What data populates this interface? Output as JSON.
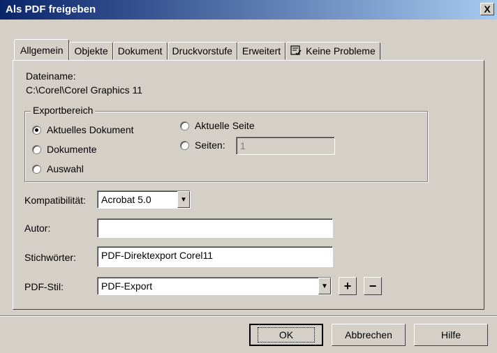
{
  "window": {
    "title": "Als PDF freigeben",
    "close_label": "X"
  },
  "tabs": [
    {
      "label": "Allgemein",
      "active": true
    },
    {
      "label": "Objekte"
    },
    {
      "label": "Dokument"
    },
    {
      "label": "Druckvorstufe"
    },
    {
      "label": "Erweitert"
    },
    {
      "label": "Keine Probleme",
      "icon": "checklist-icon"
    }
  ],
  "general": {
    "filename_label": "Dateiname:",
    "filename_value": "C:\\Corel\\Corel Graphics 11",
    "export_range": {
      "legend": "Exportbereich",
      "options": [
        {
          "label": "Aktuelles Dokument",
          "checked": true
        },
        {
          "label": "Dokumente",
          "checked": false
        },
        {
          "label": "Auswahl",
          "checked": false
        },
        {
          "label": "Aktuelle Seite",
          "checked": false
        },
        {
          "label": "Seiten:",
          "checked": false
        }
      ],
      "pages_value": "1"
    },
    "compatibility_label": "Kompatibilität:",
    "compatibility_value": "Acrobat 5.0",
    "author_label": "Autor:",
    "author_value": "",
    "keywords_label": "Stichwörter:",
    "keywords_value": "PDF-Direktexport Corel11",
    "style_label": "PDF-Stil:",
    "style_value": "PDF-Export",
    "add_label": "+",
    "remove_label": "−"
  },
  "buttons": {
    "ok": "OK",
    "cancel": "Abbrechen",
    "help": "Hilfe"
  }
}
